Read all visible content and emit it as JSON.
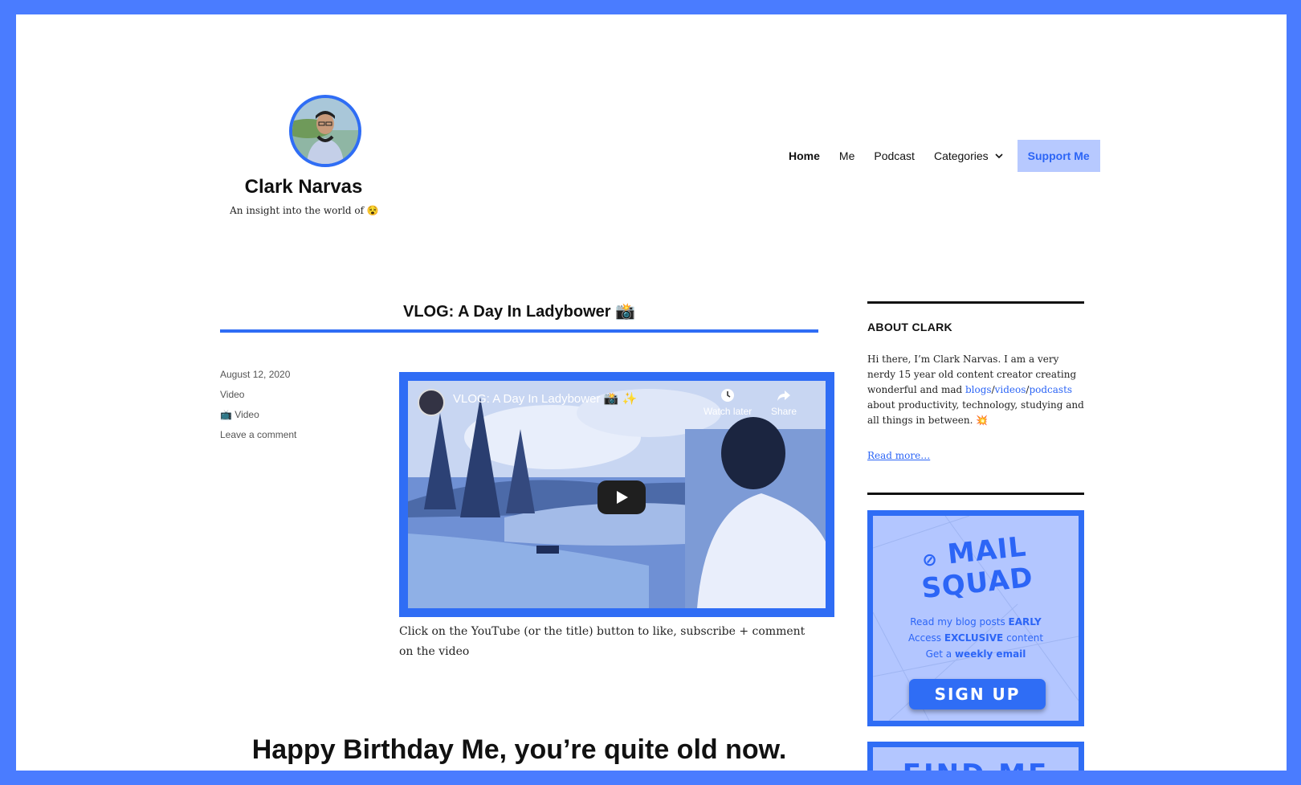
{
  "site": {
    "title": "Clark Narvas",
    "description": "An insight into the world of 😵"
  },
  "nav": {
    "items": [
      "Home",
      "Me",
      "Podcast",
      "Categories"
    ],
    "support": "Support Me"
  },
  "post": {
    "title": "VLOG: A Day In Ladybower 📸",
    "date": "August 12, 2020",
    "format": "Video",
    "category": "📺 Video",
    "comment_link": "Leave a comment",
    "body": "Click on the YouTube (or the title) button to like, subscribe + comment on the video"
  },
  "video": {
    "title": "VLOG: A Day In Ladybower 📸 ✨",
    "watch_later": "Watch later",
    "share": "Share"
  },
  "next_post": {
    "title": "Happy Birthday Me, you’re quite old now."
  },
  "sidebar": {
    "about_title": "ABOUT CLARK",
    "about_pre": "Hi there, I’m Clark Narvas. I am a very nerdy 15 year old content creator creating wonderful and mad ",
    "link_blogs": "blogs",
    "link_videos": "videos",
    "link_podcasts": "podcasts",
    "about_post": " about productivity, technology, studying and all things in between. 💥",
    "read_more": "Read more…",
    "mail_logo_line1": "MAIL",
    "mail_logo_line2": "SQUAD",
    "mail_line1_pre": "Read my blog posts ",
    "mail_line1_bold": "EARLY",
    "mail_line2_pre": "Access ",
    "mail_line2_bold": "EXCLUSIVE",
    "mail_line2_post": " content",
    "mail_line3_pre": "Get a ",
    "mail_line3_bold": "weekly email",
    "signup": "SIGN UP",
    "find_me": "FIND ME"
  },
  "colors": {
    "accent": "#2f6df5",
    "frame": "#4a7cff",
    "support_bg": "#b7c9ff"
  }
}
